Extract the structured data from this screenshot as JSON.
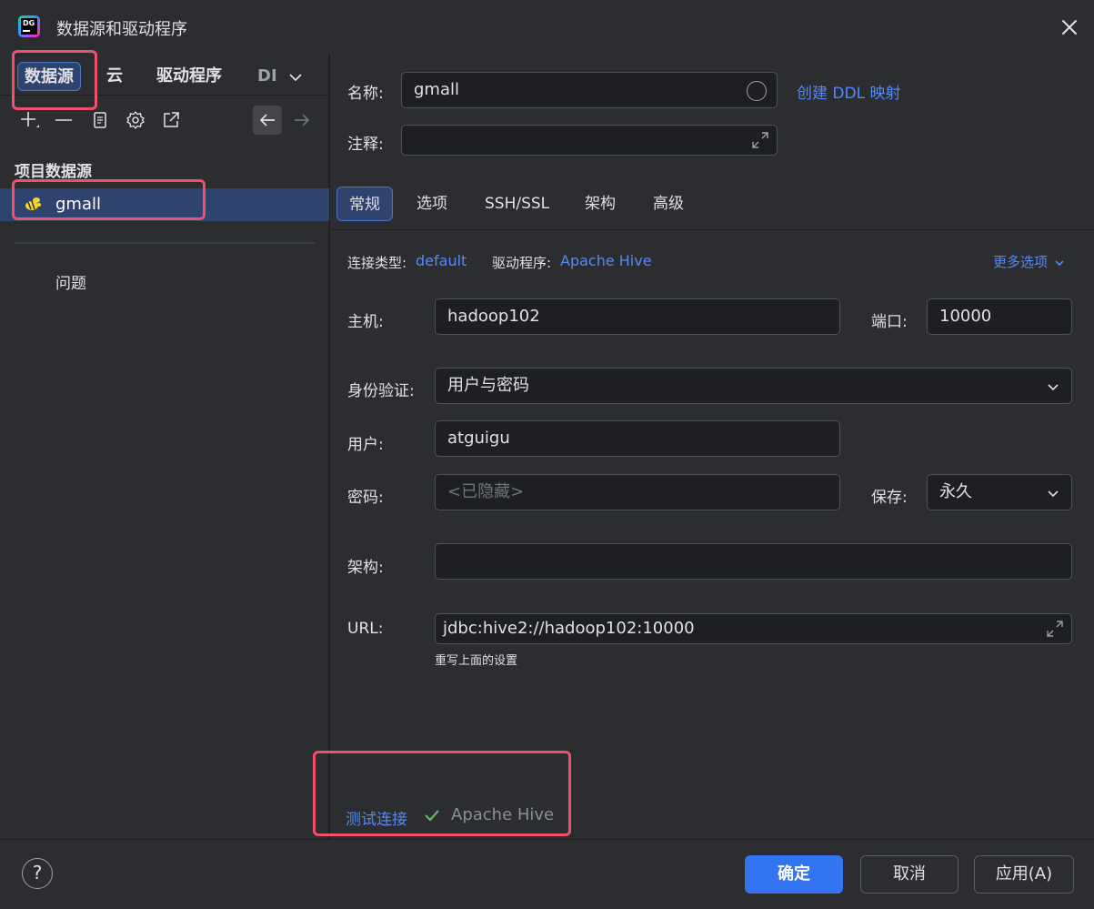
{
  "window": {
    "title": "数据源和驱动程序"
  },
  "sidebar": {
    "tabs": [
      {
        "label": "数据源"
      },
      {
        "label": "云"
      },
      {
        "label": "驱动程序"
      },
      {
        "label": "DI"
      }
    ],
    "section_label": "项目数据源",
    "datasource": {
      "name": "gmall"
    },
    "problems_label": "问题"
  },
  "form": {
    "name_label": "名称:",
    "name_value": "gmall",
    "ddl_link": "创建 DDL 映射",
    "comment_label": "注释:",
    "tabs": [
      {
        "label": "常规"
      },
      {
        "label": "选项"
      },
      {
        "label": "SSH/SSL"
      },
      {
        "label": "架构"
      },
      {
        "label": "高级"
      }
    ],
    "connection_type_label": "连接类型:",
    "connection_type_value": "default",
    "driver_label": "驱动程序:",
    "driver_value": "Apache Hive",
    "more_options": "更多选项",
    "host_label": "主机:",
    "host_value": "hadoop102",
    "port_label": "端口:",
    "port_value": "10000",
    "auth_label": "身份验证:",
    "auth_value": "用户与密码",
    "user_label": "用户:",
    "user_value": "atguigu",
    "password_label": "密码:",
    "password_placeholder": "<已隐藏>",
    "save_label": "保存:",
    "save_value": "永久",
    "schema_label": "架构:",
    "schema_value": "",
    "url_label": "URL:",
    "url_value": "jdbc:hive2://hadoop102:10000",
    "url_hint": "重写上面的设置"
  },
  "test": {
    "link": "测试连接",
    "result": "Apache Hive"
  },
  "footer": {
    "help": "?",
    "ok": "确定",
    "cancel": "取消",
    "apply": "应用(A)"
  },
  "colors": {
    "accent": "#3574f0",
    "link": "#548af7",
    "selection": "#2e436e",
    "highlight_box": "#f0506e",
    "success": "#5fb865"
  }
}
